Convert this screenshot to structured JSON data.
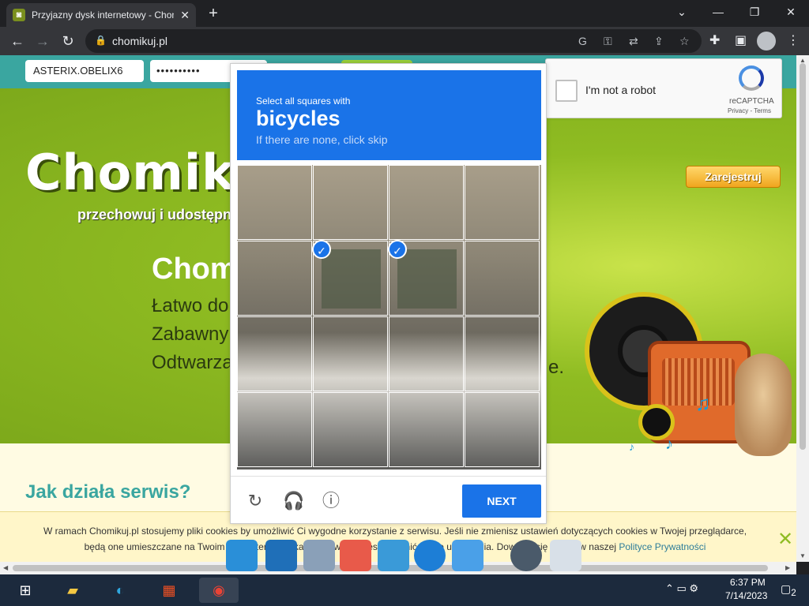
{
  "browser": {
    "tab_title": "Przyjazny dysk internetowy - Chomikuj.pl",
    "url": "chomikuj.pl"
  },
  "site": {
    "login_value": "ASTERIX.OBELIX6",
    "password_mask": "••••••••••",
    "logo": "Chomikuj.",
    "tagline": "przechowuj i udostępni",
    "hero_title": "Chom",
    "hero_lines": [
      "Łatwo do",
      "Zabawny",
      "Odtwarza"
    ],
    "hero_dot": "e.",
    "register_label": "Zarejestruj",
    "howto_heading": "Jak działa serwis?",
    "cookie_text_line1": "W ramach Chomikuj.pl stosujemy pliki cookies by umożliwić Ci wygodne korzystanie z serwisu. Jeśli nie zmienisz ustawień dotyczących cookies w Twojej przeglądarce,",
    "cookie_text_line2": "będą one umieszczane na Twoim komputerze. W każdej chwili możesz zmienić swoje ustawienia. Dowiedz się więcej w naszej",
    "cookie_link": "Polityce Prywatności",
    "cookie_close": "✕"
  },
  "recaptcha": {
    "label": "I'm not a robot",
    "brand": "reCAPTCHA",
    "links": "Privacy - Terms"
  },
  "challenge": {
    "instruction": "Select all squares with",
    "object": "bicycles",
    "hint": "If there are none, click skip",
    "selected_cells": [
      5,
      6
    ],
    "next_label": "NEXT"
  },
  "taskbar": {
    "time": "6:37 PM",
    "date": "7/14/2023",
    "notifications": "2"
  },
  "colors": {
    "challenge_blue": "#1a73e8",
    "topbar_teal": "#3aa6a0",
    "hero_green": "#8fbc22"
  }
}
